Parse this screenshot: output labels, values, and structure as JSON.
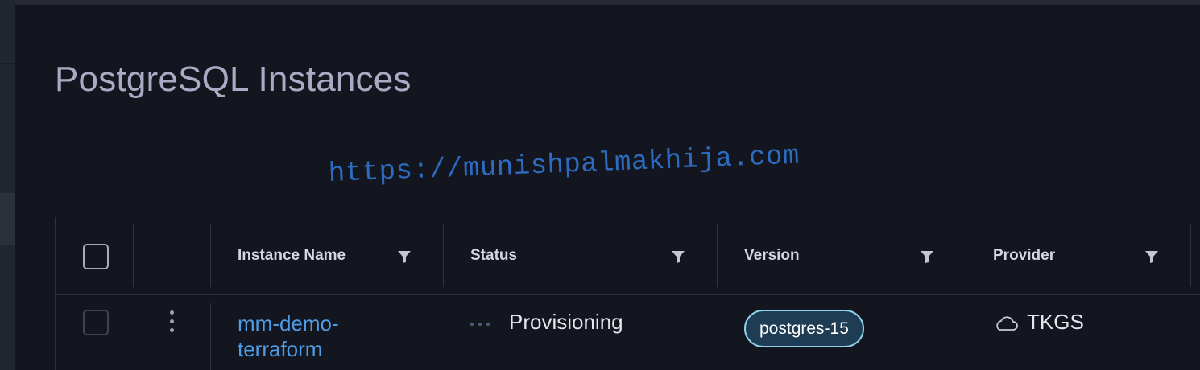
{
  "page": {
    "title": "PostgreSQL Instances",
    "watermark": "https://munishpalmakhija.com"
  },
  "grid": {
    "columns": [
      {
        "label": "Instance Name",
        "filter_icon": "filter-icon"
      },
      {
        "label": "Status",
        "filter_icon": "filter-icon"
      },
      {
        "label": "Version",
        "filter_icon": "filter-icon"
      },
      {
        "label": "Provider",
        "filter_icon": "filter-icon"
      }
    ],
    "rows": [
      {
        "instance_name": "mm-demo-terraform",
        "status": "Provisioning",
        "status_icon": "loading-dots-icon",
        "version": "postgres-15",
        "provider": "TKGS",
        "provider_icon": "cloud-icon",
        "selected": false
      }
    ]
  },
  "colors": {
    "background": "#13161e",
    "title": "#a9abc4",
    "link": "#4d9de8",
    "badge_border": "#8fd3ee",
    "badge_fill": "#1e3c54",
    "watermark": "#2c6bbf"
  }
}
